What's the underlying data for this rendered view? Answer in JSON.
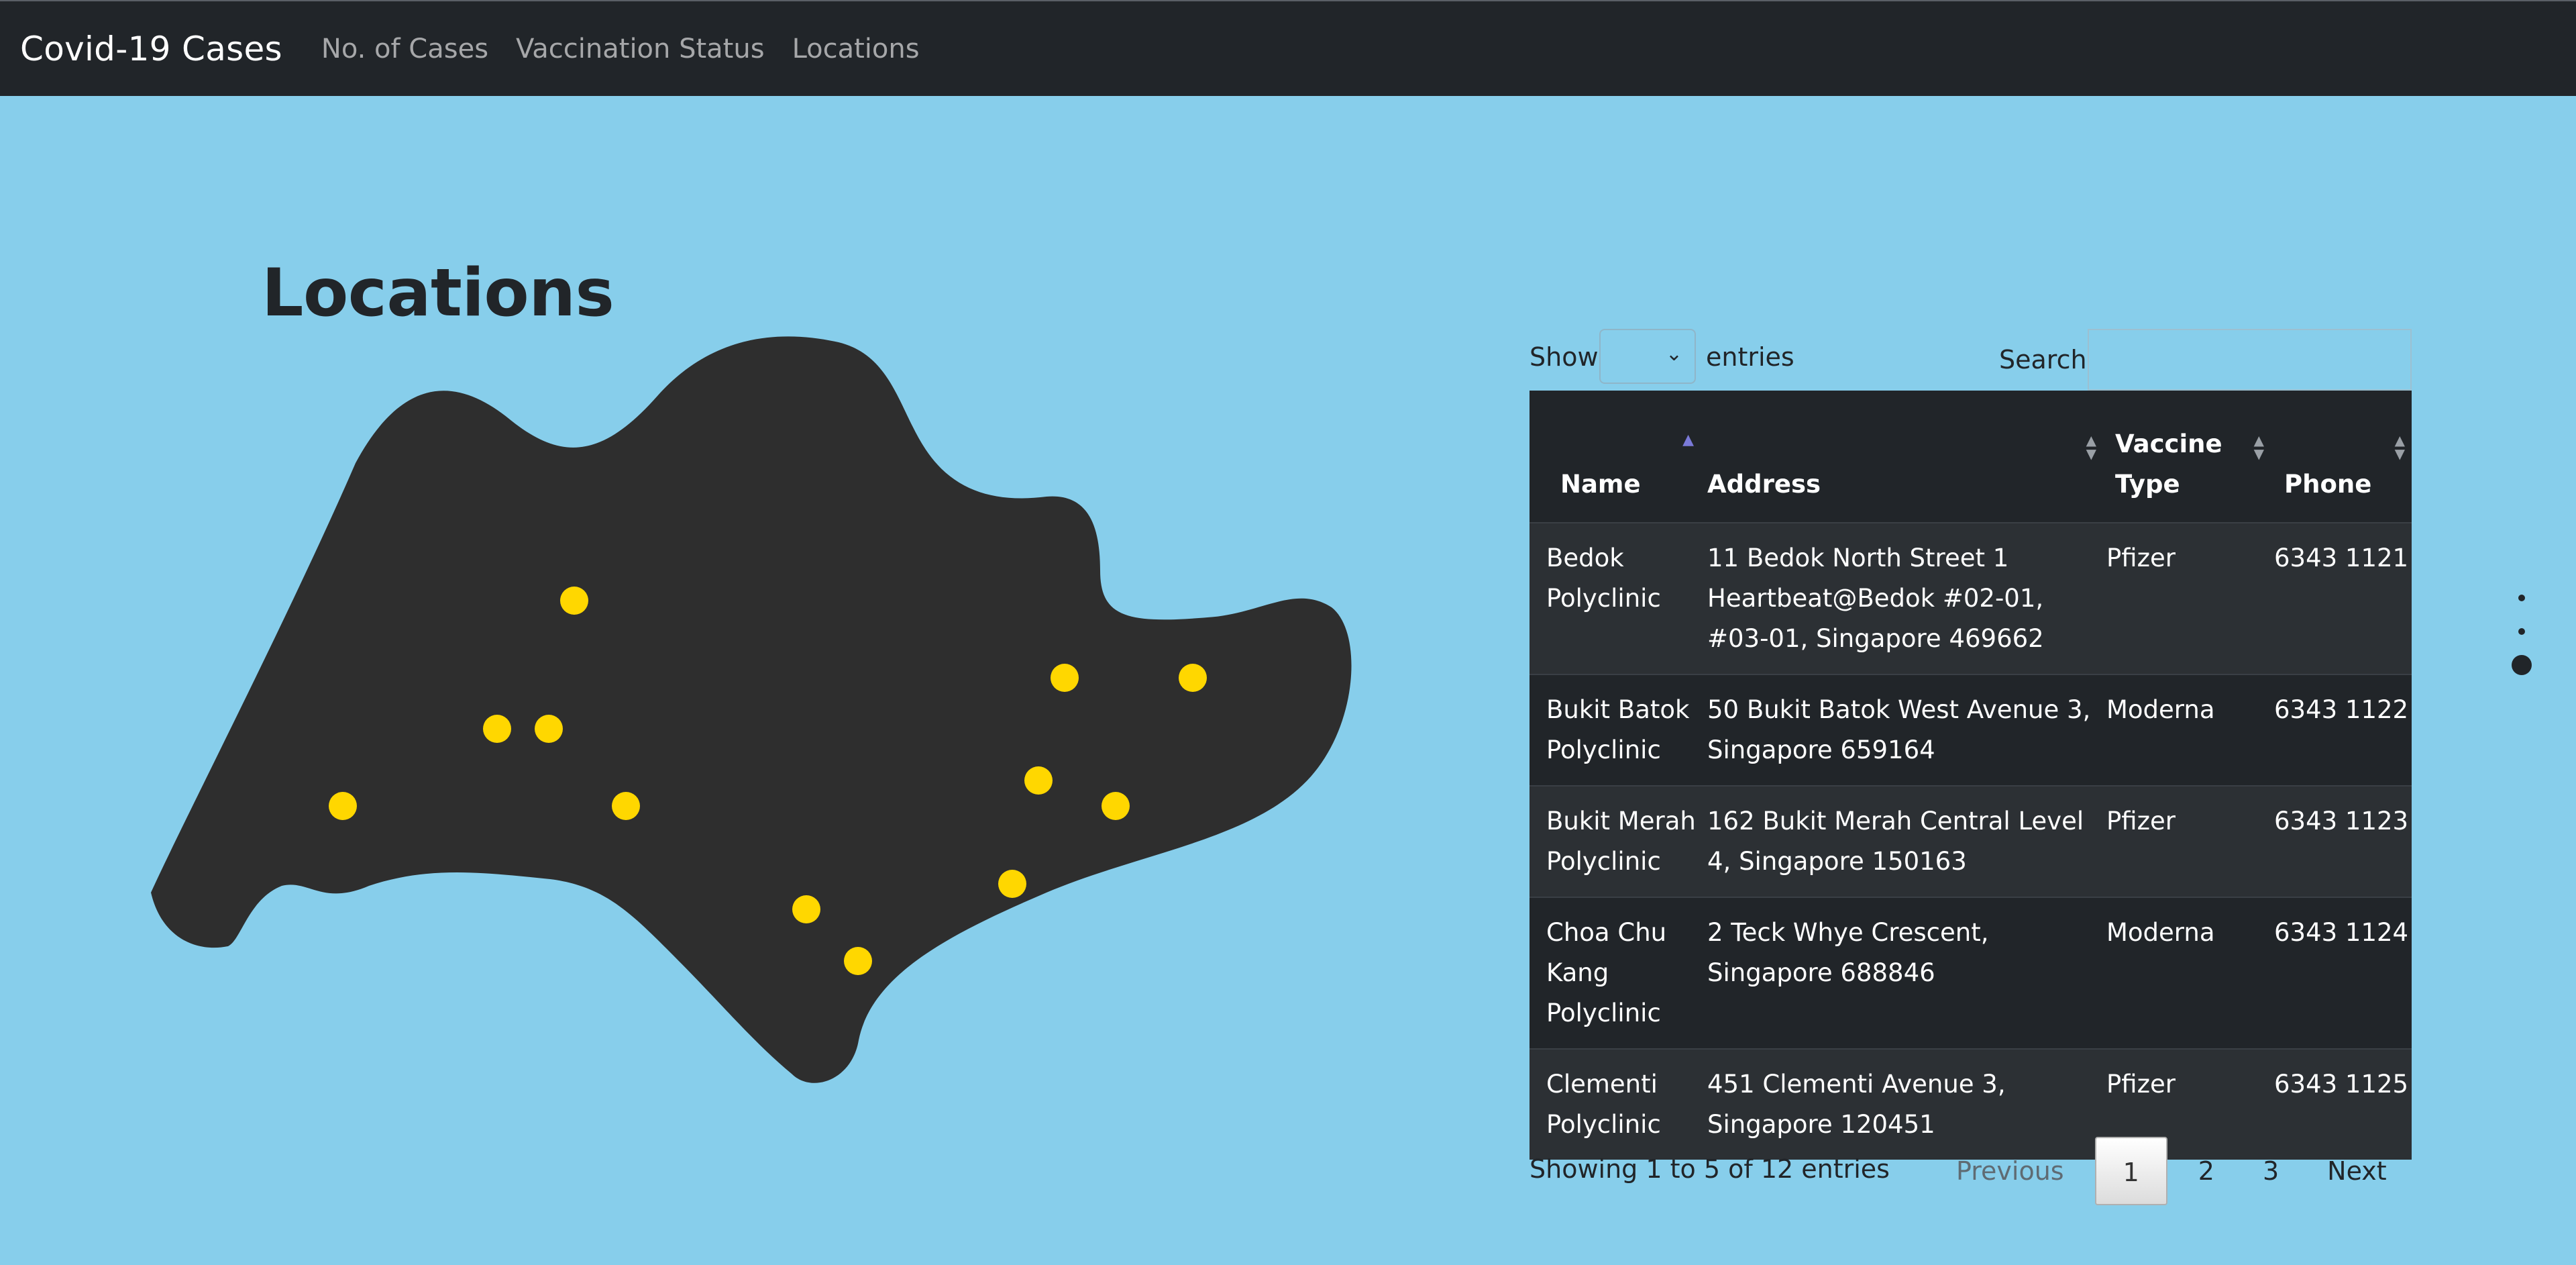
{
  "navbar": {
    "brand": "Covid-19 Cases",
    "links": [
      {
        "label": "No. of Cases"
      },
      {
        "label": "Vaccination Status"
      },
      {
        "label": "Locations"
      }
    ]
  },
  "page": {
    "title": "Locations"
  },
  "map": {
    "land_color": "#2e2e2e",
    "marker_color": "#ffd700",
    "marker_count": 13
  },
  "table": {
    "show_label": "Show",
    "entries_label": "entries",
    "search_label": "Search:",
    "search_value": "",
    "columns": [
      {
        "label": "Name",
        "sort": "asc"
      },
      {
        "label": "Address",
        "sort": "both"
      },
      {
        "label": "Vaccine Type",
        "sort": "both"
      },
      {
        "label": "Phone",
        "sort": "both"
      }
    ],
    "rows": [
      {
        "name": "Bedok Polyclinic",
        "address": "11 Bedok North Street 1 Heartbeat@Bedok #02-01, #03-01, Singapore 469662",
        "vaccine": "Pfizer",
        "phone": "6343 1121"
      },
      {
        "name": "Bukit Batok Polyclinic",
        "address": "50 Bukit Batok West Avenue 3, Singapore 659164",
        "vaccine": "Moderna",
        "phone": "6343 1122"
      },
      {
        "name": "Bukit Merah Polyclinic",
        "address": "162 Bukit Merah Central Level 4, Singapore 150163",
        "vaccine": "Pfizer",
        "phone": "6343 1123"
      },
      {
        "name": "Choa Chu Kang Polyclinic",
        "address": "2 Teck Whye Crescent, Singapore 688846",
        "vaccine": "Moderna",
        "phone": "6343 1124"
      },
      {
        "name": "Clementi Polyclinic",
        "address": "451 Clementi Avenue 3, Singapore 120451",
        "vaccine": "Pfizer",
        "phone": "6343 1125"
      }
    ],
    "info": "Showing 1 to 5 of 12 entries",
    "pagination": {
      "previous": "Previous",
      "pages": [
        "1",
        "2",
        "3"
      ],
      "current": "1",
      "next": "Next"
    }
  },
  "colors": {
    "background": "#87ceeb",
    "navbar": "#212529",
    "table_dark": "#212529",
    "table_stripe": "#2c3034"
  }
}
